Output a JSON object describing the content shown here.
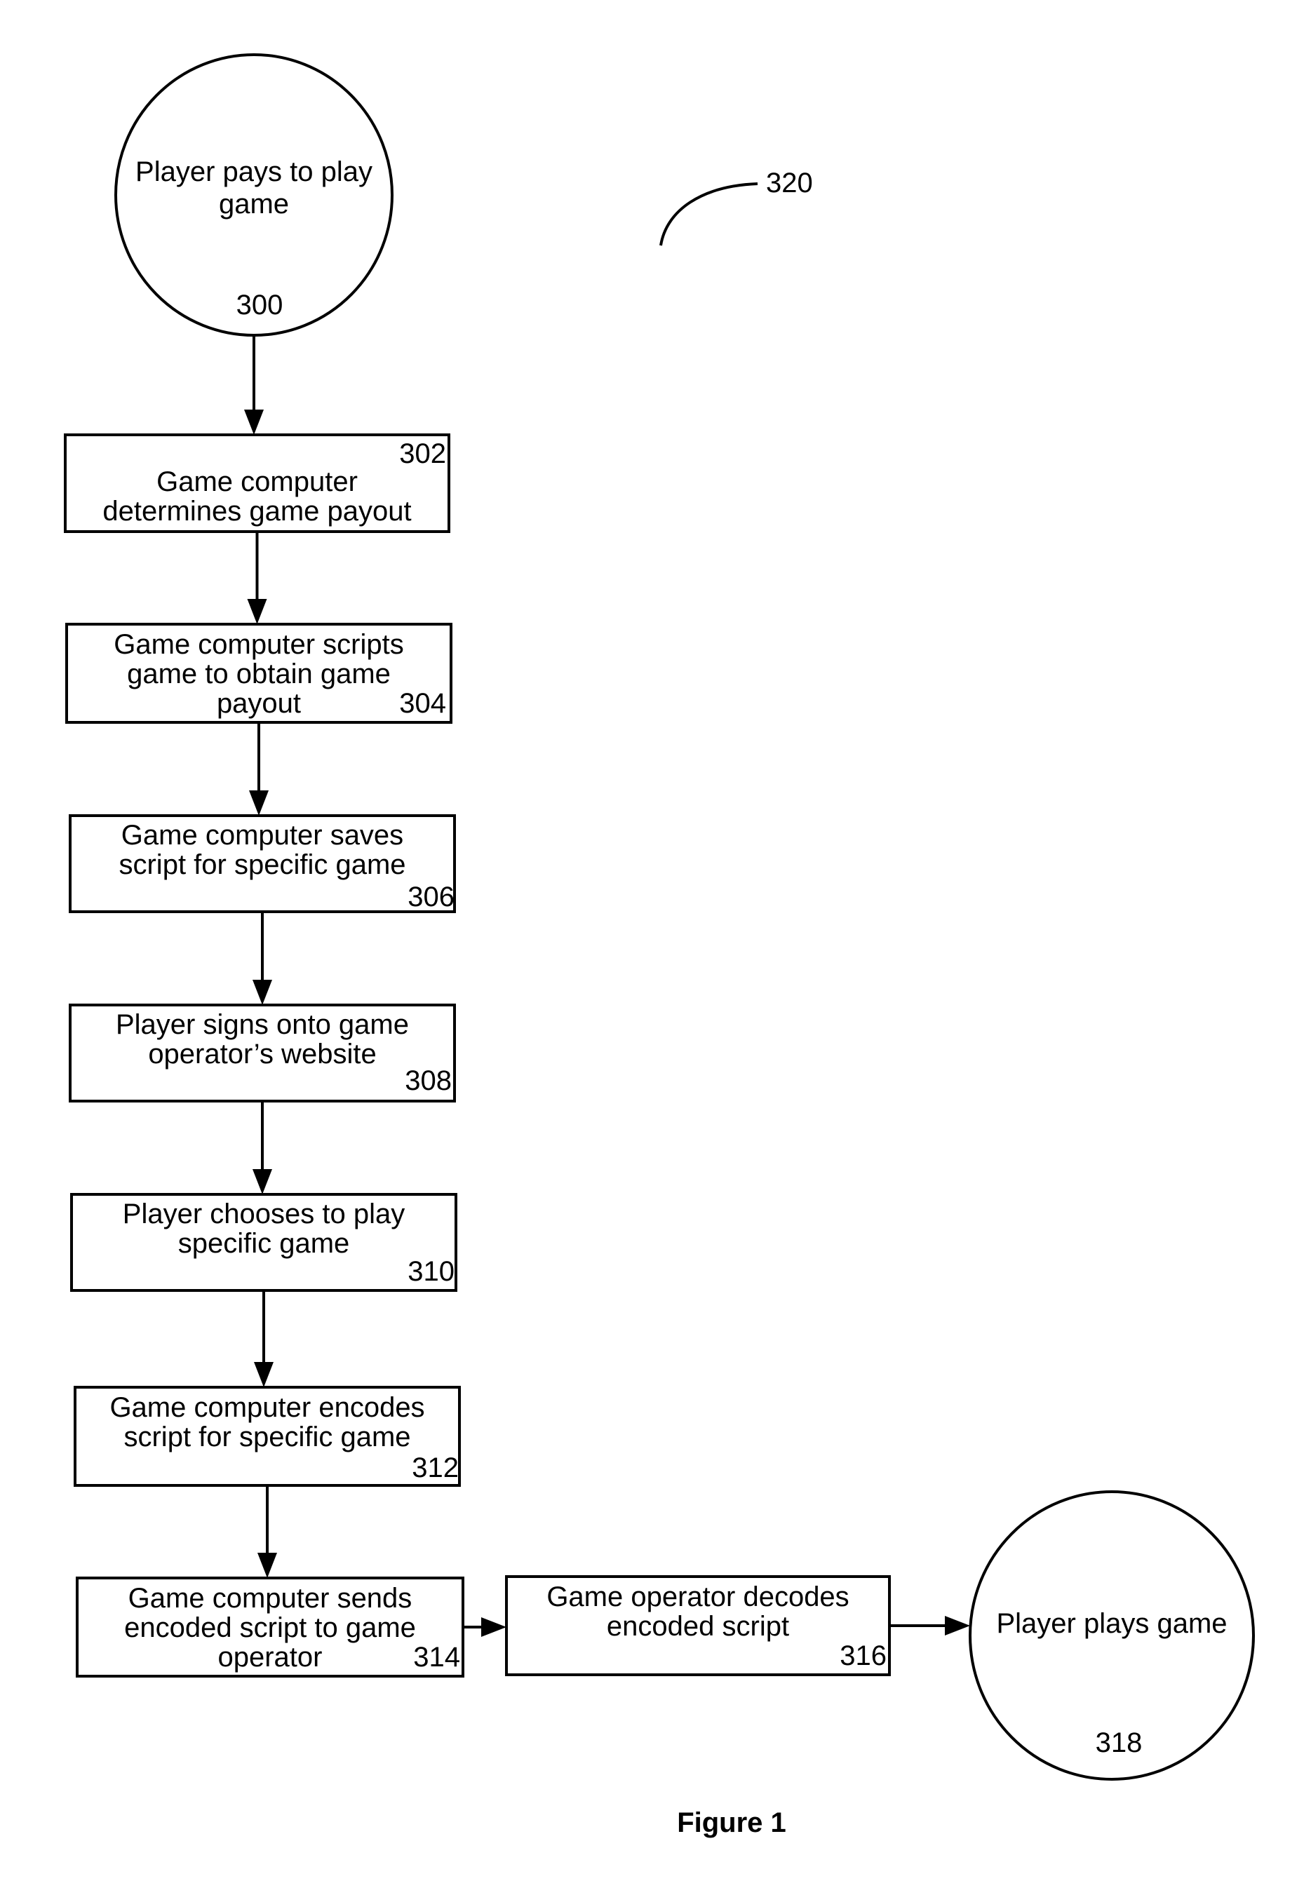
{
  "figure": {
    "caption": "Figure 1",
    "reference_label": "320"
  },
  "nodes": [
    {
      "id": "300",
      "shape": "circle",
      "lines": [
        "Player pays to play",
        "game"
      ],
      "ref": "300"
    },
    {
      "id": "302",
      "shape": "box",
      "lines": [
        "Game computer",
        "determines game payout"
      ],
      "ref": "302"
    },
    {
      "id": "304",
      "shape": "box",
      "lines": [
        "Game computer scripts",
        "game to obtain game",
        "payout"
      ],
      "ref": "304"
    },
    {
      "id": "306",
      "shape": "box",
      "lines": [
        "Game computer saves",
        "script for specific game"
      ],
      "ref": "306"
    },
    {
      "id": "308",
      "shape": "box",
      "lines": [
        "Player signs onto game",
        "operator’s website"
      ],
      "ref": "308"
    },
    {
      "id": "310",
      "shape": "box",
      "lines": [
        "Player chooses to play",
        "specific game"
      ],
      "ref": "310"
    },
    {
      "id": "312",
      "shape": "box",
      "lines": [
        "Game computer encodes",
        "script for specific game"
      ],
      "ref": "312"
    },
    {
      "id": "314",
      "shape": "box",
      "lines": [
        "Game computer sends",
        "encoded script to game",
        "operator"
      ],
      "ref": "314"
    },
    {
      "id": "316",
      "shape": "box",
      "lines": [
        "Game operator decodes",
        "encoded script"
      ],
      "ref": "316"
    },
    {
      "id": "318",
      "shape": "circle",
      "lines": [
        "Player plays game"
      ],
      "ref": "318"
    }
  ],
  "edges": [
    {
      "from": "300",
      "to": "302"
    },
    {
      "from": "302",
      "to": "304"
    },
    {
      "from": "304",
      "to": "306"
    },
    {
      "from": "306",
      "to": "308"
    },
    {
      "from": "308",
      "to": "310"
    },
    {
      "from": "310",
      "to": "312"
    },
    {
      "from": "312",
      "to": "314"
    },
    {
      "from": "314",
      "to": "316"
    },
    {
      "from": "316",
      "to": "318"
    }
  ]
}
